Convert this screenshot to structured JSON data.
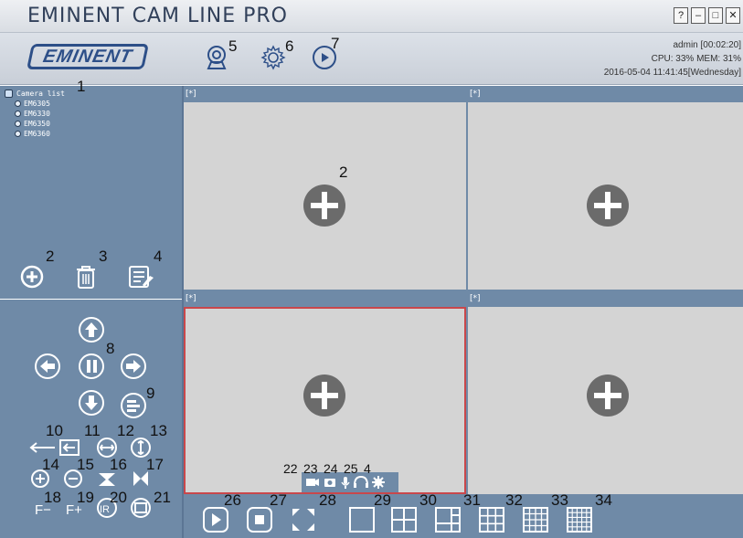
{
  "window": {
    "title": "EMINENT CAM LINE PRO",
    "buttons": [
      "?",
      "–",
      "□",
      "✕"
    ]
  },
  "header": {
    "logo_text": "EMINENT",
    "sys_user": "admin  [00:02:20]",
    "sys_usage": "CPU: 33%  MEM: 31%",
    "sys_datetime": "2016-05-04 11:41:45[Wednesday]",
    "icons": [
      "camera-setup-icon",
      "settings-icon",
      "playback-icon"
    ]
  },
  "sidebar": {
    "camera_list_label": "Camera list",
    "cameras": [
      "EM6305",
      "EM6330",
      "EM6350",
      "EM6360"
    ],
    "actions": [
      "add-camera-icon",
      "delete-camera-icon",
      "edit-camera-icon"
    ]
  },
  "ptz": {
    "focus_minus": "F−",
    "focus_plus": "F+",
    "ir_label": "IR"
  },
  "panes": [
    {
      "label": "[*]"
    },
    {
      "label": "[*]"
    },
    {
      "label": "[*]"
    },
    {
      "label": "[*]"
    }
  ],
  "callouts": {
    "n1": "1",
    "n2a": "2",
    "n2b": "2",
    "n3": "3",
    "n4a": "4",
    "n4b": "4",
    "n5": "5",
    "n6": "6",
    "n7": "7",
    "n8": "8",
    "n9": "9",
    "n10": "10",
    "n11": "11",
    "n12": "12",
    "n13": "13",
    "n14": "14",
    "n15": "15",
    "n16": "16",
    "n17": "17",
    "n18": "18",
    "n19": "19",
    "n20": "20",
    "n21": "21",
    "n22": "22",
    "n23": "23",
    "n24": "24",
    "n25": "25",
    "n26": "26",
    "n27": "27",
    "n28": "28",
    "n29": "29",
    "n30": "30",
    "n31": "31",
    "n32": "32",
    "n33": "33",
    "n34": "34"
  },
  "colors": {
    "panel_bg": "#6f8aa7",
    "pane_bg": "#d4d4d4",
    "active_border": "#c9474b",
    "logo_blue": "#2d4f88"
  }
}
